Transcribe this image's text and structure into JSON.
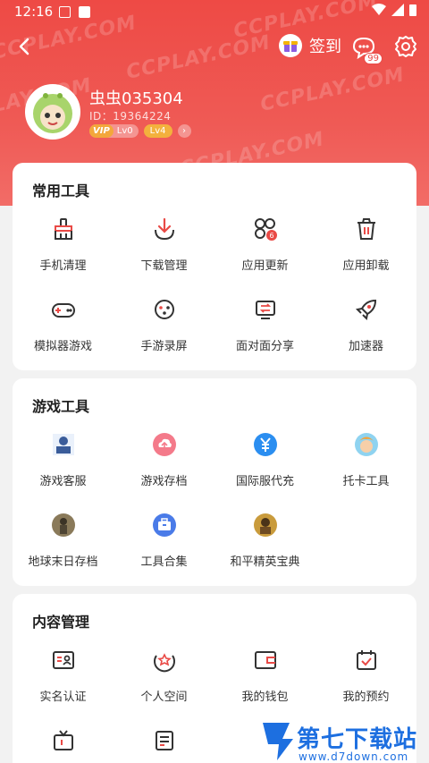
{
  "status": {
    "time": "12:16"
  },
  "header": {
    "signin_label": "签到",
    "msg_badge": "99",
    "user": {
      "name": "虫虫035304",
      "id": "ID：19364224",
      "vip_level": "Lv0",
      "vip_tag": "VIP",
      "level": "Lv4"
    },
    "watermark": "CCPLAY.COM"
  },
  "sections": [
    {
      "title": "常用工具",
      "items": [
        {
          "label": "手机清理",
          "icon": "broom-icon"
        },
        {
          "label": "下载管理",
          "icon": "download-icon"
        },
        {
          "label": "应用更新",
          "icon": "app-update-icon"
        },
        {
          "label": "应用卸载",
          "icon": "trash-icon"
        },
        {
          "label": "模拟器游戏",
          "icon": "gamepad-icon"
        },
        {
          "label": "手游录屏",
          "icon": "record-icon"
        },
        {
          "label": "面对面分享",
          "icon": "share-icon"
        },
        {
          "label": "加速器",
          "icon": "rocket-icon"
        }
      ]
    },
    {
      "title": "游戏工具",
      "items": [
        {
          "label": "游戏客服",
          "icon": "service-icon"
        },
        {
          "label": "游戏存档",
          "icon": "cloud-upload-icon"
        },
        {
          "label": "国际服代充",
          "icon": "yuan-icon"
        },
        {
          "label": "托卡工具",
          "icon": "toca-icon"
        },
        {
          "label": "地球末日存档",
          "icon": "earth-doom-icon"
        },
        {
          "label": "工具合集",
          "icon": "toolbox-icon"
        },
        {
          "label": "和平精英宝典",
          "icon": "pubg-icon"
        }
      ]
    },
    {
      "title": "内容管理",
      "items": [
        {
          "label": "实名认证",
          "icon": "id-card-icon"
        },
        {
          "label": "个人空间",
          "icon": "star-space-icon"
        },
        {
          "label": "我的钱包",
          "icon": "wallet-icon"
        },
        {
          "label": "我的预约",
          "icon": "calendar-check-icon"
        },
        {
          "label": "",
          "icon": "tv-icon"
        },
        {
          "label": "",
          "icon": "document-icon"
        },
        {
          "label": "",
          "icon": "folder-icon"
        },
        {
          "label": "",
          "icon": "box-icon"
        }
      ]
    }
  ],
  "site_logo": {
    "title": "第七下载站",
    "url": "www.d7down.com"
  },
  "colors": {
    "accent": "#e94a46",
    "header": "#ee4a45"
  }
}
